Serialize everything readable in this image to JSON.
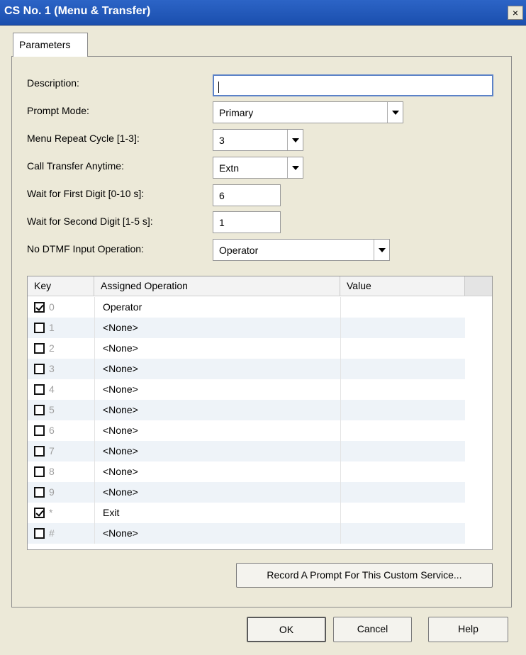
{
  "window": {
    "title": "CS No. 1 (Menu & Transfer)",
    "close_glyph": "×"
  },
  "tabs": [
    {
      "label": "Parameters",
      "selected": true
    }
  ],
  "form": {
    "description": {
      "label": "Description:",
      "value": ""
    },
    "prompt_mode": {
      "label": "Prompt Mode:",
      "value": "Primary"
    },
    "menu_repeat": {
      "label": "Menu Repeat Cycle [1-3]:",
      "value": "3"
    },
    "call_transfer": {
      "label": "Call Transfer Anytime:",
      "value": "Extn"
    },
    "first_digit": {
      "label": "Wait for First Digit [0-10 s]:",
      "value": "6"
    },
    "second_digit": {
      "label": "Wait for Second Digit [1-5 s]:",
      "value": "1"
    },
    "no_dtmf": {
      "label": "No DTMF Input Operation:",
      "value": "Operator"
    }
  },
  "table": {
    "columns": [
      "Key",
      "Assigned Operation",
      "Value"
    ],
    "rows": [
      {
        "key": "0",
        "checked": true,
        "operation": "Operator",
        "value": ""
      },
      {
        "key": "1",
        "checked": false,
        "operation": "<None>",
        "value": ""
      },
      {
        "key": "2",
        "checked": false,
        "operation": "<None>",
        "value": ""
      },
      {
        "key": "3",
        "checked": false,
        "operation": "<None>",
        "value": ""
      },
      {
        "key": "4",
        "checked": false,
        "operation": "<None>",
        "value": ""
      },
      {
        "key": "5",
        "checked": false,
        "operation": "<None>",
        "value": ""
      },
      {
        "key": "6",
        "checked": false,
        "operation": "<None>",
        "value": ""
      },
      {
        "key": "7",
        "checked": false,
        "operation": "<None>",
        "value": ""
      },
      {
        "key": "8",
        "checked": false,
        "operation": "<None>",
        "value": ""
      },
      {
        "key": "9",
        "checked": false,
        "operation": "<None>",
        "value": ""
      },
      {
        "key": "*",
        "checked": true,
        "operation": "Exit",
        "value": ""
      },
      {
        "key": "#",
        "checked": false,
        "operation": "<None>",
        "value": ""
      }
    ]
  },
  "buttons": {
    "record_prompt": "Record A Prompt For This Custom Service...",
    "ok": "OK",
    "cancel": "Cancel",
    "help": "Help"
  },
  "colors": {
    "titlebar": "#1b4fae",
    "dialog_bg": "#ece9d8",
    "row_alt": "#eef3f8"
  }
}
